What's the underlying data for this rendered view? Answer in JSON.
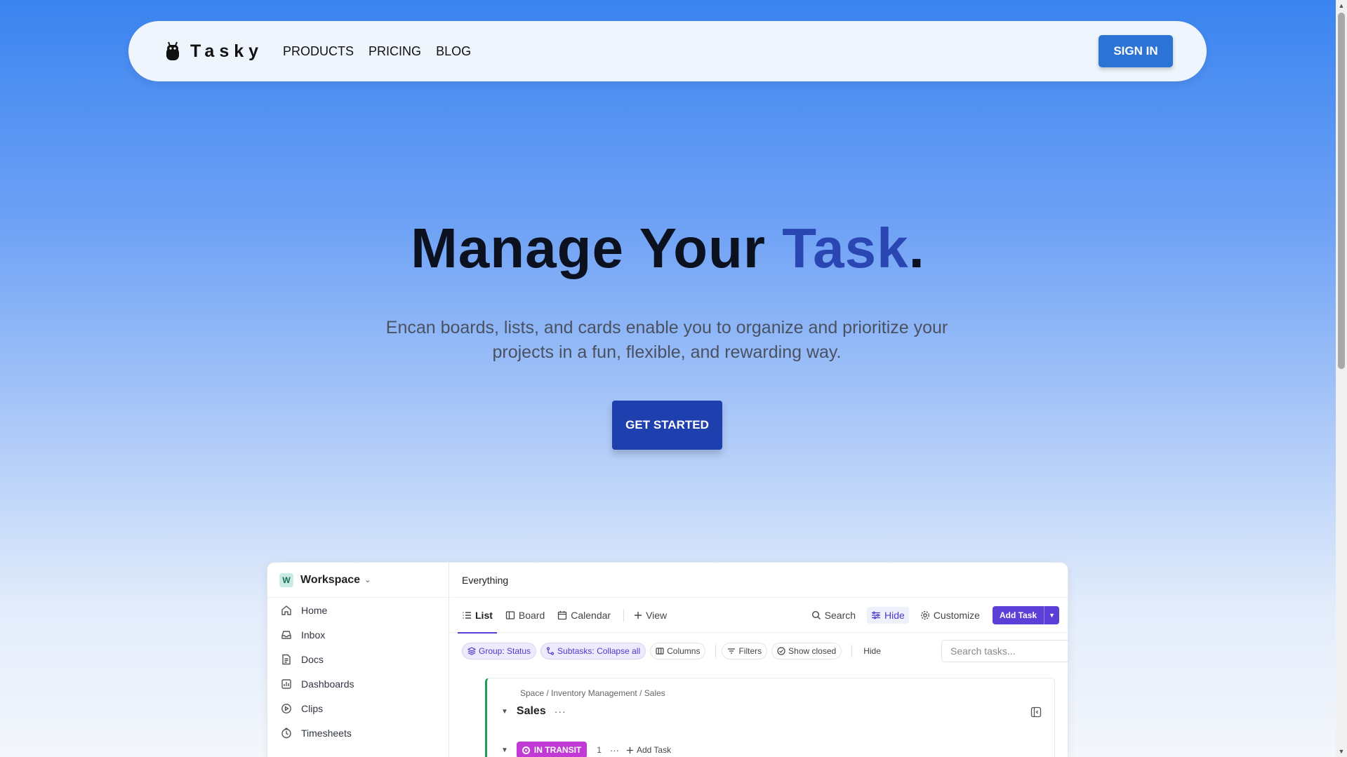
{
  "nav": {
    "brand": "Tasky",
    "links": [
      "PRODUCTS",
      "PRICING",
      "BLOG"
    ],
    "signin": "SIGN IN"
  },
  "hero": {
    "title_main": "Manage Your ",
    "title_accent": "Task",
    "title_end": ".",
    "subtitle_line1": "Encan boards, lists, and cards enable you to organize and prioritize your",
    "subtitle_line2": "projects in a fun, flexible, and rewarding way.",
    "cta": "GET STARTED"
  },
  "app": {
    "workspace": {
      "badge": "W",
      "name": "Workspace"
    },
    "sidebar": [
      {
        "label": "Home",
        "icon": "home-icon"
      },
      {
        "label": "Inbox",
        "icon": "inbox-icon"
      },
      {
        "label": "Docs",
        "icon": "doc-icon"
      },
      {
        "label": "Dashboards",
        "icon": "dashboard-icon"
      },
      {
        "label": "Clips",
        "icon": "clips-icon"
      },
      {
        "label": "Timesheets",
        "icon": "timesheet-icon"
      }
    ],
    "breadcrumb": "Everything",
    "views": {
      "list": "List",
      "board": "Board",
      "calendar": "Calendar",
      "add": "View"
    },
    "toolbar": {
      "search": "Search",
      "hide": "Hide",
      "customize": "Customize",
      "add_task": "Add Task"
    },
    "filters": {
      "group": "Group: Status",
      "subtasks": "Subtasks: Collapse all",
      "columns": "Columns",
      "filters": "Filters",
      "show_closed": "Show closed",
      "hide": "Hide",
      "search_placeholder": "Search tasks..."
    },
    "list": {
      "path": "Space / Inventory Management / Sales",
      "name": "Sales",
      "status": "IN TRANSIT",
      "count": "1",
      "add_task": "Add Task"
    },
    "colors": {
      "accent": "#5b3fd6",
      "status": "#c13ad6",
      "list_bar": "#1f9d55"
    }
  }
}
